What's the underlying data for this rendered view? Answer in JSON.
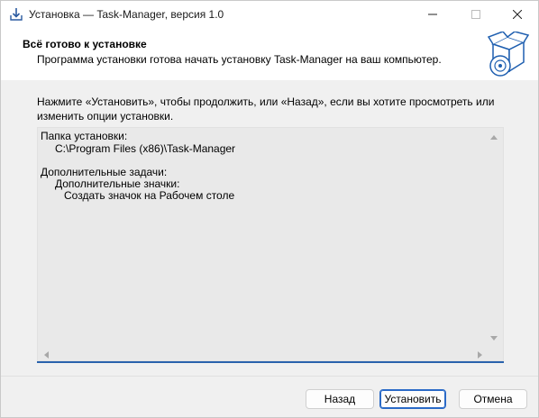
{
  "window": {
    "title": "Установка — Task-Manager, версия 1.0"
  },
  "header": {
    "title": "Всё готово к установке",
    "subtitle": "Программа установки готова начать установку Task-Manager на ваш компьютер."
  },
  "main": {
    "instruction": "Нажмите «Установить», чтобы продолжить, или «Назад», если вы хотите просмотреть или изменить опции установки.",
    "memo": {
      "dest_label": "Папка установки:",
      "dest_path": "C:\\Program Files (x86)\\Task-Manager",
      "tasks_label": "Дополнительные задачи:",
      "icons_label": "Дополнительные значки:",
      "desktop_icon": "Создать значок на Рабочем столе"
    }
  },
  "footer": {
    "back_label": "Назад",
    "install_label": "Установить",
    "cancel_label": "Отмена"
  },
  "colors": {
    "accent": "#2a63ad",
    "memo_bg": "#e9e9e9",
    "body_bg": "#f0f0f0"
  }
}
